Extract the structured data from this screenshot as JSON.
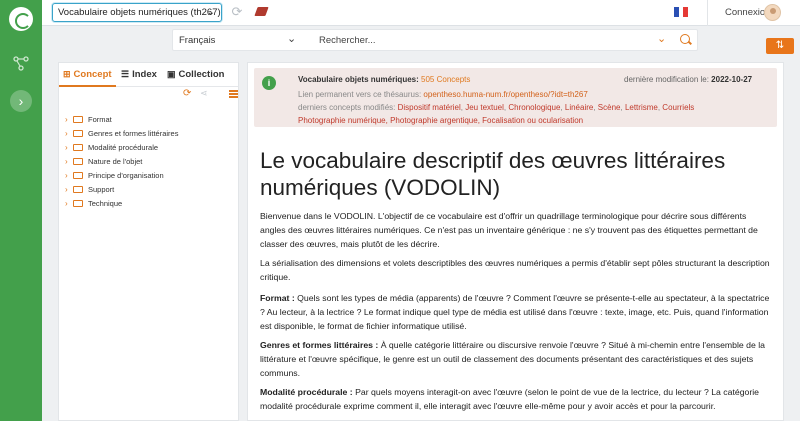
{
  "topbar": {
    "thesaurus_select": "Vocabulaire objets numériques (th267)",
    "login_label": "Connexion"
  },
  "search": {
    "language": "Français",
    "placeholder": "Rechercher..."
  },
  "tabs": [
    {
      "label": "Concept",
      "icon": "sitemap-icon"
    },
    {
      "label": "Index",
      "icon": "list-icon"
    },
    {
      "label": "Collection",
      "icon": "collection-icon"
    }
  ],
  "tree": [
    {
      "label": "Format"
    },
    {
      "label": "Genres et formes littéraires"
    },
    {
      "label": "Modalité procédurale"
    },
    {
      "label": "Nature de l'objet"
    },
    {
      "label": "Principe d'organisation"
    },
    {
      "label": "Support"
    },
    {
      "label": "Technique"
    }
  ],
  "info": {
    "title": "Vocabulaire objets numériques:",
    "concept_count": "505 Concepts",
    "last_modified_label": "dernière modification le:",
    "last_modified_date": "2022-10-27",
    "permalink_label": "Lien permanent vers ce thésaurus:",
    "permalink_url": "opentheso.huma-num.fr/opentheso/?idt=th267",
    "recent_label": "derniers concepts modifiés:",
    "recent_concepts": [
      "Dispositif matériel",
      "Jeu textuel",
      "Chronologique",
      "Linéaire",
      "Scène",
      "Lettrisme",
      "Courriels",
      "Photographie numérique",
      "Photographie argentique",
      "Focalisation ou ocularisation"
    ]
  },
  "main": {
    "title": "Le vocabulaire descriptif des œuvres littéraires numériques (VODOLIN)",
    "intro": "Bienvenue dans le VODOLIN. L'objectif de ce vocabulaire est d'offrir un quadrillage terminologique pour décrire sous différents angles des œuvres littéraires numériques. Ce n'est pas un inventaire générique : ne s'y trouvent pas des étiquettes permettant de classer des œuvres, mais plutôt de les décrire.",
    "serialisation": "La sérialisation des dimensions et volets descriptibles des œuvres numériques a permis d'établir sept pôles structurant la description critique.",
    "sections": [
      {
        "term": "Format :",
        "text": " Quels sont les types de média (apparents) de l'œuvre ? Comment l'œuvre se présente-t-elle au spectateur, à la spectatrice ? Au lecteur, à la lectrice ? Le format indique quel type de média est utilisé dans l'œuvre : texte, image, etc. Puis, quand l'information est disponible, le format de fichier informatique utilisé."
      },
      {
        "term": "Genres et formes littéraires :",
        "text": " À quelle catégorie littéraire ou discursive renvoie l'œuvre ? Situé à mi-chemin entre l'ensemble de la littérature et l'œuvre spécifique, le genre est un outil de classement des documents présentant des caractéristiques et des sujets communs."
      },
      {
        "term": "Modalité procédurale :",
        "text": " Par quels moyens interagit-on avec l'œuvre (selon le point de vue de la lectrice, du lecteur ? La catégorie modalité procédurale exprime comment il, elle interagit avec l'œuvre elle-même pour y avoir accès et pour la parcourir."
      }
    ]
  },
  "colors": {
    "rail": "#43a04b",
    "accent": "#e0791f",
    "link": "#c0392b"
  }
}
